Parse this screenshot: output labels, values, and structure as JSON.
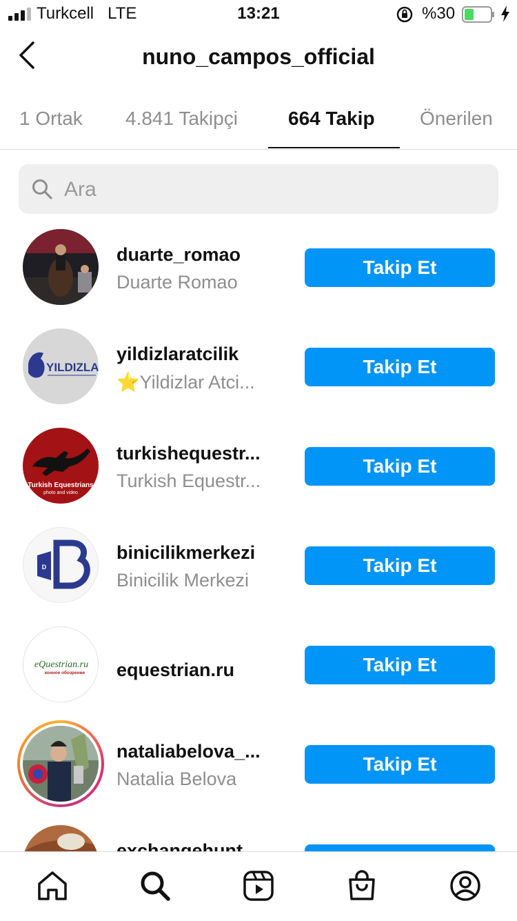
{
  "status_bar": {
    "carrier": "Turkcell   LTE",
    "time": "13:21",
    "battery": "%30"
  },
  "header": {
    "title": "nuno_campos_official"
  },
  "tabs": [
    {
      "label": "1 Ortak"
    },
    {
      "label": "4.841 Takipçi"
    },
    {
      "label": "664 Takip"
    },
    {
      "label": "Önerilen"
    }
  ],
  "search": {
    "placeholder": "Ara"
  },
  "follow_label": "Takip Et",
  "accounts": [
    {
      "username": "duarte_romao",
      "full_name": "Duarte Romao"
    },
    {
      "username": "yildizlaratcilik",
      "full_name": "⭐Yildizlar Atci..."
    },
    {
      "username": "turkishequestr...",
      "full_name": "Turkish Equestr..."
    },
    {
      "username": "binicilikmerkezi",
      "full_name": "Binicilik Merkezi"
    },
    {
      "username": "equestrian.ru",
      "full_name": ""
    },
    {
      "username": "nataliabelova_...",
      "full_name": "Natalia Belova"
    },
    {
      "username": "exchangehunt",
      "full_name": ""
    }
  ],
  "logos": {
    "yildizlar": "YILDIZLAR",
    "turkish": "Turkish Equestrians",
    "turkish_sub": "photo and video",
    "equestrian": "eQuestrian.ru",
    "equestrian_sub": "конное обозрение"
  },
  "colors": {
    "accent": "#0095f6",
    "muted": "#8e8e8e"
  }
}
